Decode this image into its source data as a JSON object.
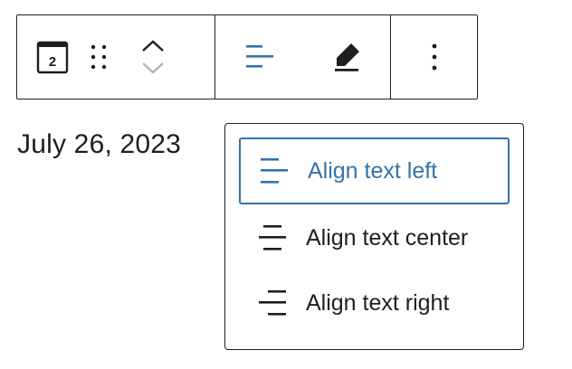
{
  "toolbar": {
    "block_icon": "calendar-icon",
    "block_icon_text": "2",
    "drag_icon": "drag-handle-icon",
    "move_up_icon": "chevron-up-icon",
    "move_down_icon": "chevron-down-icon",
    "align_icon": "align-left-icon",
    "highlight_icon": "highlighter-icon",
    "options_icon": "more-vertical-icon"
  },
  "content": {
    "date_text": "July 26, 2023"
  },
  "align_menu": {
    "items": [
      {
        "label": "Align text left",
        "icon": "align-left-icon",
        "active": true
      },
      {
        "label": "Align text center",
        "icon": "align-center-icon",
        "active": false
      },
      {
        "label": "Align text right",
        "icon": "align-right-icon",
        "active": false
      }
    ]
  },
  "colors": {
    "accent": "#3672a8",
    "text": "#1e1e1e",
    "disabled": "#b4b4b4",
    "border": "#1e1e1e"
  }
}
